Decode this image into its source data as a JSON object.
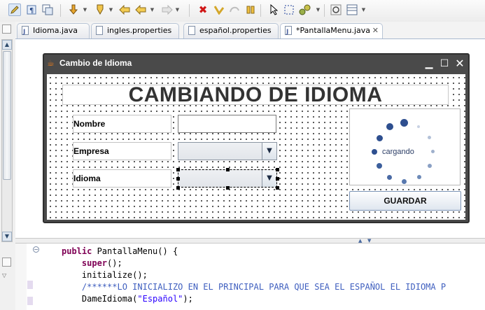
{
  "toolbar": {
    "icons": [
      "pencil-icon",
      "paragraph-icon",
      "copy-icon",
      "download-icon",
      "run-icon",
      "back-icon",
      "back-arrow-icon",
      "forward-arrow-icon",
      "delete-icon",
      "undo-icon",
      "redo-icon",
      "pause-icon",
      "pointer-icon",
      "marquee-icon",
      "wrench-icon",
      "refresh-icon",
      "layout-icon"
    ]
  },
  "tabs": [
    {
      "label": "Idioma.java",
      "active": false
    },
    {
      "label": "ingles.properties",
      "active": false
    },
    {
      "label": "español.properties",
      "active": false
    },
    {
      "label": "*PantallaMenu.java",
      "active": true
    }
  ],
  "window": {
    "title": "Cambio de Idioma",
    "minimize": "▁",
    "maximize": "☐",
    "close": "✕"
  },
  "form": {
    "heading": "CAMBIANDO DE IDIOMA",
    "nombre_label": "Nombre",
    "empresa_label": "Empresa",
    "idioma_label": "Idioma",
    "loading_text": "cargando",
    "save_button": "GUARDAR",
    "combo_arrow": "▼"
  },
  "code": {
    "lines": [
      {
        "parts": [
          {
            "t": "public ",
            "c": "kw"
          },
          {
            "t": "PantallaMenu() {",
            "c": ""
          }
        ]
      },
      {
        "parts": [
          {
            "t": "    ",
            "c": ""
          },
          {
            "t": "super",
            "c": "kw"
          },
          {
            "t": "();",
            "c": ""
          }
        ]
      },
      {
        "parts": [
          {
            "t": "    initialize();",
            "c": ""
          }
        ]
      },
      {
        "parts": [
          {
            "t": "    /******LO INICIALIZO EN EL PRINCIPAL PARA QUE SEA EL ESPAÑOL EL IDIOMA P",
            "c": "cm"
          }
        ]
      },
      {
        "parts": [
          {
            "t": "    DameIdioma(",
            "c": ""
          },
          {
            "t": "\"Español\"",
            "c": "str"
          },
          {
            "t": ");",
            "c": ""
          }
        ]
      }
    ]
  },
  "colors": {
    "frame_dark": "#4a4a4a",
    "accent_blue": "#2e4f8f",
    "keyword": "#7f0055",
    "comment": "#3f5fbf",
    "string": "#2a00ff"
  }
}
